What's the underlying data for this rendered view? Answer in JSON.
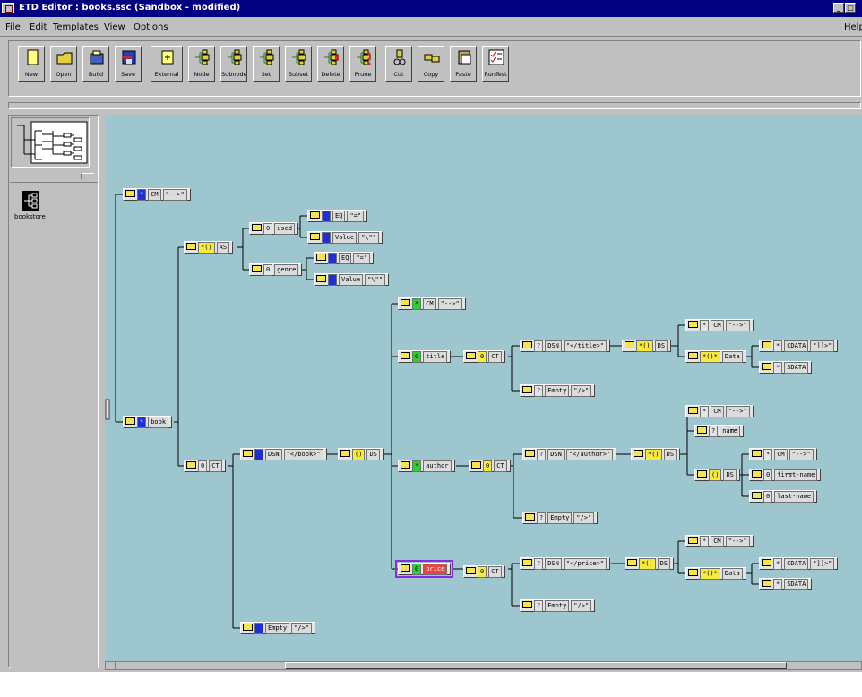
{
  "window": {
    "title": "ETD Editor : books.ssc (Sandbox - modified)"
  },
  "menu": [
    "File",
    "Edit",
    "Templates",
    "View",
    "Options"
  ],
  "help_label": "Help",
  "toolbar": [
    {
      "label": "New",
      "icon": "new-file-icon"
    },
    {
      "label": "Open",
      "icon": "open-folder-icon"
    },
    {
      "label": "Build",
      "icon": "build-icon"
    },
    {
      "label": "Save",
      "icon": "save-icon"
    },
    {
      "label": "External",
      "icon": "external-icon"
    },
    {
      "label": "Node",
      "icon": "node-icon"
    },
    {
      "label": "Subnode",
      "icon": "subnode-icon"
    },
    {
      "label": "Set",
      "icon": "set-icon"
    },
    {
      "label": "Subset",
      "icon": "subset-icon"
    },
    {
      "label": "Delete",
      "icon": "delete-icon"
    },
    {
      "label": "Prune",
      "icon": "prune-icon"
    },
    {
      "label": "Cut",
      "icon": "cut-icon"
    },
    {
      "label": "Copy",
      "icon": "copy-icon"
    },
    {
      "label": "Paste",
      "icon": "paste-icon"
    },
    {
      "label": "RunTest",
      "icon": "runtest-icon"
    }
  ],
  "navigator": {
    "item_label": "bookstore"
  },
  "colors": {
    "canvas": "#9ec6cf",
    "marker_blue": "#1f2fd8",
    "marker_yellow": "#f6e940",
    "marker_green": "#22d72a",
    "selected_red": "#e24646",
    "selected_border": "#8a2be2"
  },
  "nodes": [
    {
      "id": "n1",
      "marker": "*",
      "mcolor": "blue",
      "cells": [
        "CM",
        "\"-->\""
      ]
    },
    {
      "id": "n2",
      "marker": "*",
      "mcolor": "blue",
      "cells": [
        "book"
      ]
    },
    {
      "id": "n3",
      "marker": "*()",
      "mcolor": "yellow",
      "cells": [
        "AS"
      ]
    },
    {
      "id": "n4",
      "marker": "0",
      "mcolor": "none",
      "cells": [
        "CT"
      ]
    },
    {
      "id": "n5",
      "marker": "0",
      "mcolor": "none",
      "cells": [
        "used"
      ]
    },
    {
      "id": "n6",
      "marker": "0",
      "mcolor": "none",
      "cells": [
        "genre"
      ]
    },
    {
      "id": "n7",
      "marker": "",
      "mcolor": "blue",
      "cells": [
        "EQ",
        "\"=\""
      ]
    },
    {
      "id": "n8",
      "marker": "",
      "mcolor": "blue",
      "cells": [
        "Value",
        "\"\\\"\""
      ]
    },
    {
      "id": "n9",
      "marker": "",
      "mcolor": "blue",
      "cells": [
        "EQ",
        "\"=\""
      ]
    },
    {
      "id": "n10",
      "marker": "",
      "mcolor": "blue",
      "cells": [
        "Value",
        "\"\\\"\""
      ]
    },
    {
      "id": "n11",
      "marker": "",
      "mcolor": "blue",
      "cells": [
        "DSN",
        "\"</book>\""
      ]
    },
    {
      "id": "n12",
      "marker": "()",
      "mcolor": "yellow",
      "cells": [
        "DS"
      ]
    },
    {
      "id": "n13",
      "marker": "",
      "mcolor": "blue",
      "cells": [
        "Empty",
        "\"/>\""
      ]
    },
    {
      "id": "n14",
      "marker": "*",
      "mcolor": "green",
      "cells": [
        "CM",
        "\"-->\""
      ]
    },
    {
      "id": "n15",
      "marker": "0",
      "mcolor": "green",
      "cells": [
        "title"
      ]
    },
    {
      "id": "n16",
      "marker": "*",
      "mcolor": "green",
      "cells": [
        "author"
      ]
    },
    {
      "id": "n17",
      "marker": "0",
      "mcolor": "green",
      "cells": [
        "price"
      ],
      "selected": true
    },
    {
      "id": "n18",
      "marker": "0",
      "mcolor": "yellow",
      "cells": [
        "CT"
      ]
    },
    {
      "id": "n19",
      "marker": "0",
      "mcolor": "yellow",
      "cells": [
        "CT"
      ]
    },
    {
      "id": "n20",
      "marker": "0",
      "mcolor": "yellow",
      "cells": [
        "CT"
      ]
    },
    {
      "id": "n21",
      "marker": "?",
      "mcolor": "none",
      "cells": [
        "DSN",
        "\"</title>\""
      ]
    },
    {
      "id": "n22",
      "marker": "?",
      "mcolor": "none",
      "cells": [
        "Empty",
        "\"/>\""
      ]
    },
    {
      "id": "n23",
      "marker": "?",
      "mcolor": "none",
      "cells": [
        "DSN",
        "\"</author>\""
      ]
    },
    {
      "id": "n24",
      "marker": "?",
      "mcolor": "none",
      "cells": [
        "Empty",
        "\"/>\""
      ]
    },
    {
      "id": "n25",
      "marker": "?",
      "mcolor": "none",
      "cells": [
        "DSN",
        "\"</price>\""
      ]
    },
    {
      "id": "n26",
      "marker": "?",
      "mcolor": "none",
      "cells": [
        "Empty",
        "\"/>\""
      ]
    },
    {
      "id": "n27",
      "marker": "*()",
      "mcolor": "yellow",
      "cells": [
        "DS"
      ]
    },
    {
      "id": "n28",
      "marker": "*()",
      "mcolor": "yellow",
      "cells": [
        "DS"
      ]
    },
    {
      "id": "n29",
      "marker": "*()",
      "mcolor": "yellow",
      "cells": [
        "DS"
      ]
    },
    {
      "id": "n30",
      "marker": "*",
      "mcolor": "none",
      "cells": [
        "CM",
        "\"-->\""
      ]
    },
    {
      "id": "n31",
      "marker": "*()*",
      "mcolor": "yellow",
      "cells": [
        "Data"
      ]
    },
    {
      "id": "n32",
      "marker": "*",
      "mcolor": "none",
      "cells": [
        "CDATA",
        "\"]]>\""
      ]
    },
    {
      "id": "n33",
      "marker": "*",
      "mcolor": "none",
      "cells": [
        "SDATA"
      ]
    },
    {
      "id": "n34",
      "marker": "*",
      "mcolor": "none",
      "cells": [
        "CM",
        "\"-->\""
      ]
    },
    {
      "id": "n35",
      "marker": "?",
      "mcolor": "none",
      "cells": [
        "name"
      ],
      "suffix": "---"
    },
    {
      "id": "n36",
      "marker": "()",
      "mcolor": "yellow",
      "cells": [
        "DS"
      ]
    },
    {
      "id": "n37",
      "marker": "*",
      "mcolor": "none",
      "cells": [
        "CM",
        "\"-->\""
      ]
    },
    {
      "id": "n38",
      "marker": "0",
      "mcolor": "none",
      "cells": [
        "first-name"
      ],
      "suffix": "---"
    },
    {
      "id": "n39",
      "marker": "0",
      "mcolor": "none",
      "cells": [
        "last-name"
      ],
      "suffix": "---"
    },
    {
      "id": "n40",
      "marker": "*",
      "mcolor": "none",
      "cells": [
        "CM",
        "\"-->\""
      ]
    },
    {
      "id": "n41",
      "marker": "*()*",
      "mcolor": "yellow",
      "cells": [
        "Data"
      ]
    },
    {
      "id": "n42",
      "marker": "*",
      "mcolor": "none",
      "cells": [
        "CDATA",
        "\"]]>\""
      ]
    },
    {
      "id": "n43",
      "marker": "*",
      "mcolor": "none",
      "cells": [
        "SDATA"
      ]
    }
  ]
}
